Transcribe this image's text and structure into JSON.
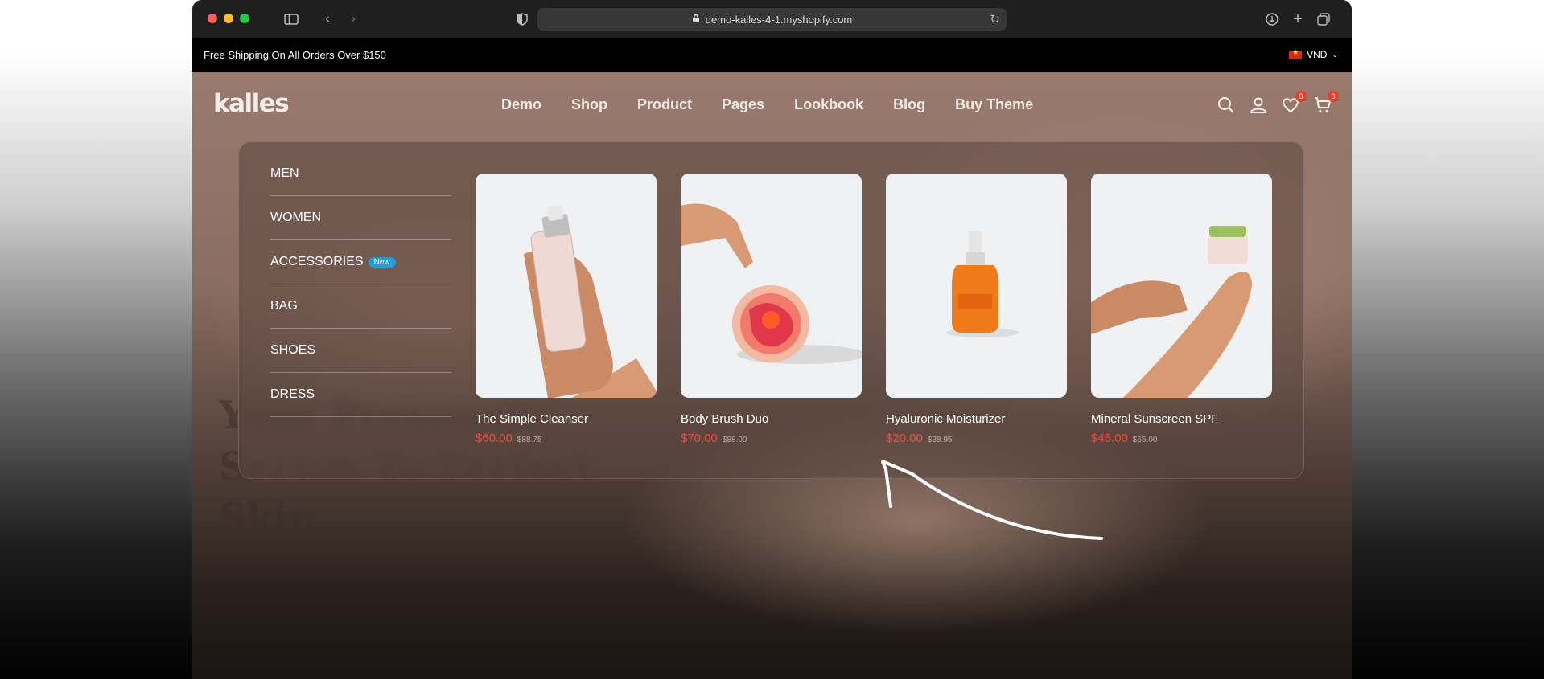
{
  "browser": {
    "url": "demo-kalles-4-1.myshopify.com"
  },
  "announcement": {
    "text": "Free Shipping On All Orders Over $150",
    "currency": "VND"
  },
  "header": {
    "logo": "kalles",
    "nav": [
      "Demo",
      "Shop",
      "Product",
      "Pages",
      "Lookbook",
      "Blog",
      "Buy Theme"
    ],
    "wishlist_count": "0",
    "cart_count": "0"
  },
  "mega_menu": {
    "categories": [
      {
        "label": "MEN",
        "badge": ""
      },
      {
        "label": "WOMEN",
        "badge": ""
      },
      {
        "label": "ACCESSORIES",
        "badge": "New"
      },
      {
        "label": "BAG",
        "badge": ""
      },
      {
        "label": "SHOES",
        "badge": ""
      },
      {
        "label": "DRESS",
        "badge": ""
      }
    ],
    "products": [
      {
        "name": "The Simple Cleanser",
        "price": "$60.00",
        "old_price": "$88.75"
      },
      {
        "name": "Body Brush Duo",
        "price": "$70.00",
        "old_price": "$88.00"
      },
      {
        "name": "Hyaluronic Moisturizer",
        "price": "$20.00",
        "old_price": "$38.95"
      },
      {
        "name": "Mineral Sunscreen SPF",
        "price": "$45.00",
        "old_price": "$65.00"
      }
    ]
  },
  "hero": {
    "title": "Your Presonalis Serum To Perfect Skin"
  },
  "colors": {
    "accent_price": "#ec4a3b",
    "badge_new": "#1e9fe0",
    "announcement_bg": "#000000"
  }
}
